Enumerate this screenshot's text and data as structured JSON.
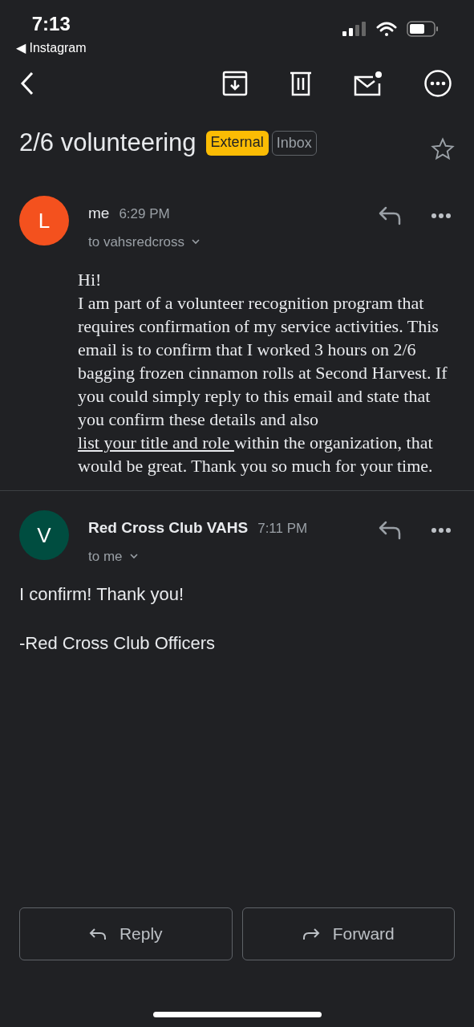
{
  "status_bar": {
    "time": "7:13",
    "back_app": "◀ Instagram"
  },
  "subject": {
    "title": "2/6 volunteering",
    "labels": [
      {
        "text": "External",
        "kind": "external"
      },
      {
        "text": "Inbox",
        "kind": "folder"
      }
    ],
    "starred": false
  },
  "messages": [
    {
      "avatar_letter": "L",
      "color": "#f4511e",
      "sender": "me",
      "time": "6:29 PM",
      "recipient": "to vahsredcross",
      "kind": "original",
      "greeting": "Hi!",
      "body_before": "I am part of a volunteer recognition program that requires confirmation of my service activities. This email is to confirm that I worked 3 hours on 2/6 bagging frozen cinnamon rolls at Second Harvest. If you could simply reply to this email and state that you confirm these details and also ",
      "link": "list your title and role ",
      "body_after": "within the organization, that would be great. Thank you so much for your time."
    },
    {
      "avatar_letter": "V",
      "color": "#004d40",
      "sender": "Red Cross Club VAHS",
      "time": "7:11 PM",
      "recipient": "to me",
      "kind": "reply",
      "paragraphs": [
        "I confirm! Thank you!",
        "-Red Cross Club Officers"
      ]
    }
  ],
  "actions": [
    {
      "label": "Reply",
      "kind": "reply"
    },
    {
      "label": "Forward",
      "kind": "forward"
    }
  ]
}
